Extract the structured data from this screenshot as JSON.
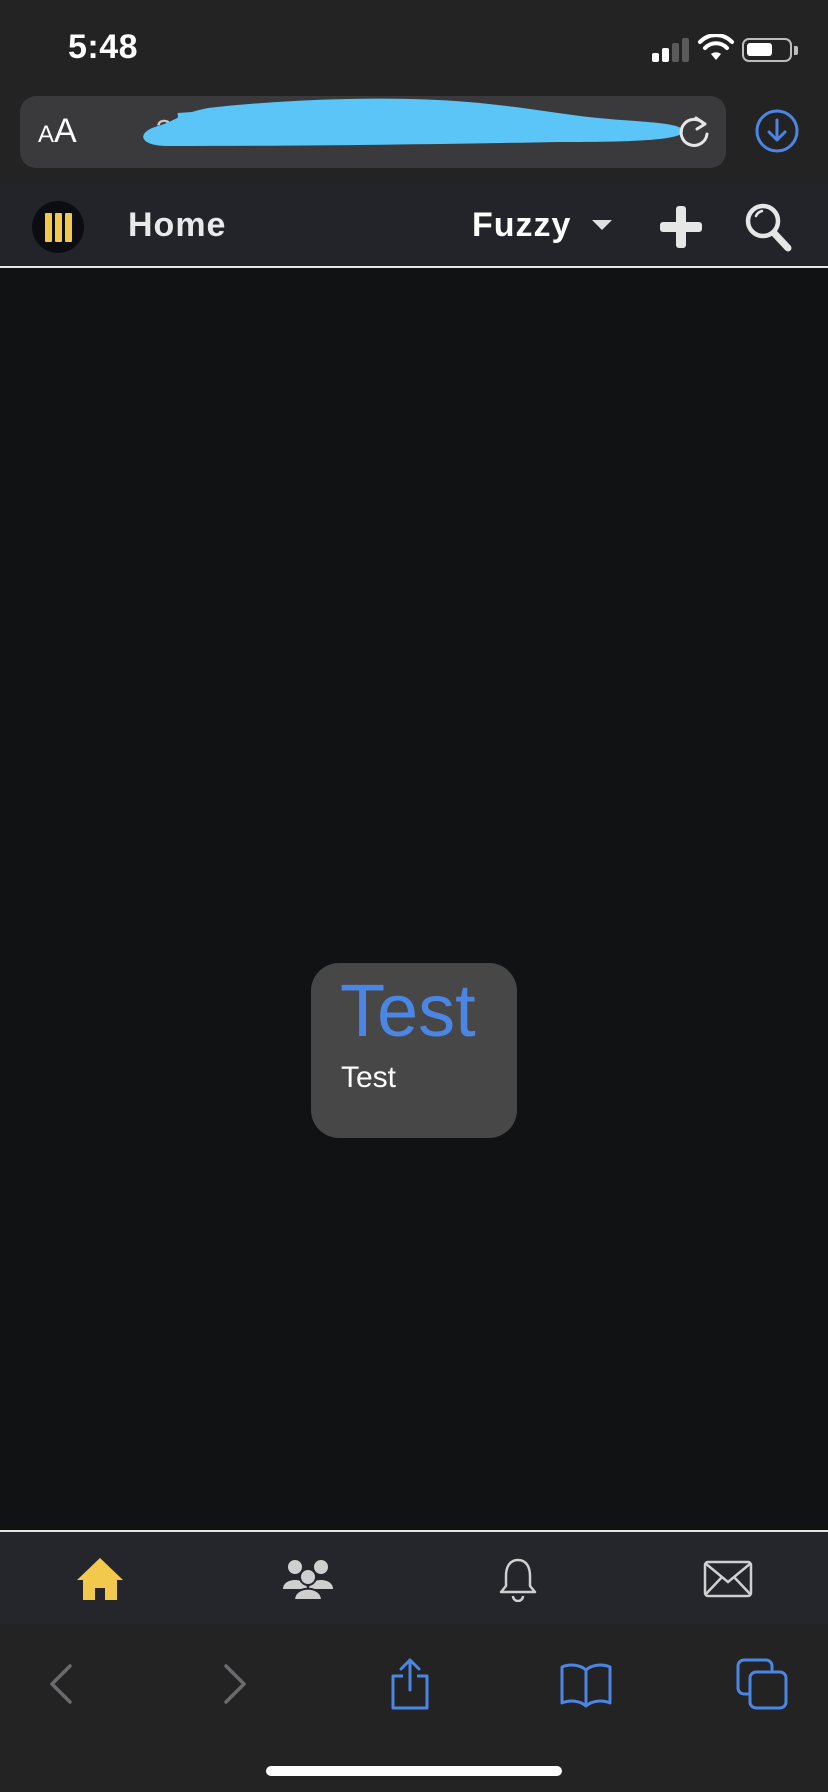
{
  "status_bar": {
    "time": "5:48"
  },
  "browser": {
    "aa_small": "A",
    "aa_large": "A",
    "url_visible_fragment": "?",
    "url_redaction_color": "#5bc5f8",
    "accent_color": "#4b86e4"
  },
  "site_nav": {
    "home_label": "Home",
    "user_label": "Fuzzy",
    "logo_color": "#f2c94c"
  },
  "card": {
    "title": "Test",
    "subtitle": "Test",
    "title_color": "#4b86e4"
  },
  "tabbar": {
    "items": [
      {
        "icon": "home-icon",
        "active": true,
        "color": "#f2c94c"
      },
      {
        "icon": "group-icon",
        "active": false
      },
      {
        "icon": "bell-icon",
        "active": false
      },
      {
        "icon": "mail-icon",
        "active": false
      }
    ]
  },
  "browser_toolbar": {
    "items": [
      "back-icon",
      "forward-icon",
      "share-icon",
      "bookmarks-icon",
      "tabs-icon"
    ]
  }
}
